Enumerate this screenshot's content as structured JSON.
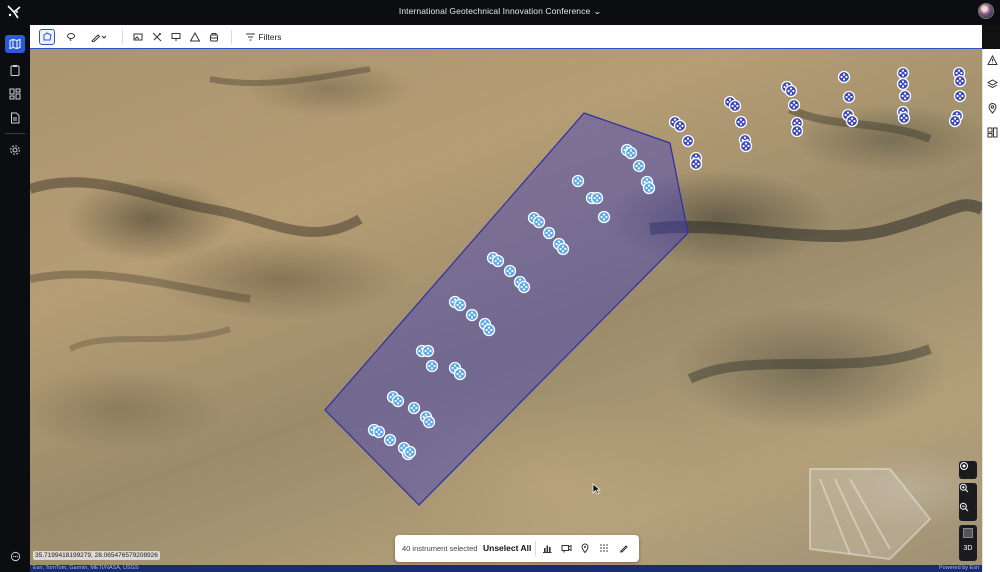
{
  "app": {
    "project_title": "International Geotechnical Innovation Conference"
  },
  "toolbar": {
    "filters_label": "Filters"
  },
  "map": {
    "coordinates": "35.7199418199279, 28.065476579208926",
    "attribution_left": "Esri, TomTom, Garmin, METI/NASA, USGS",
    "attribution_right": "Powered by Esri",
    "view_mode_label": "3D",
    "selection_polygon_color": "#3b3fc8"
  },
  "selection": {
    "count_text": "40 instrument selected",
    "unselect_label": "Unselect All"
  },
  "icons": {
    "leftnav": [
      "map-icon",
      "clipboard-icon",
      "dashboard-icon",
      "document-icon",
      "settings-icon",
      "chat-icon"
    ],
    "toolbar": [
      "polygon-select-icon",
      "lasso-select-icon",
      "draw-icon",
      "image-icon",
      "edit-points-icon",
      "presentation-icon",
      "warning-outline-icon",
      "store-icon",
      "filter-icon"
    ],
    "rightrail": [
      "alert-icon",
      "layers-icon",
      "location-icon",
      "widgets-icon"
    ],
    "selection": [
      "chart-icon",
      "camera-icon",
      "pin-icon",
      "grid-dots-icon",
      "pen-icon"
    ]
  }
}
